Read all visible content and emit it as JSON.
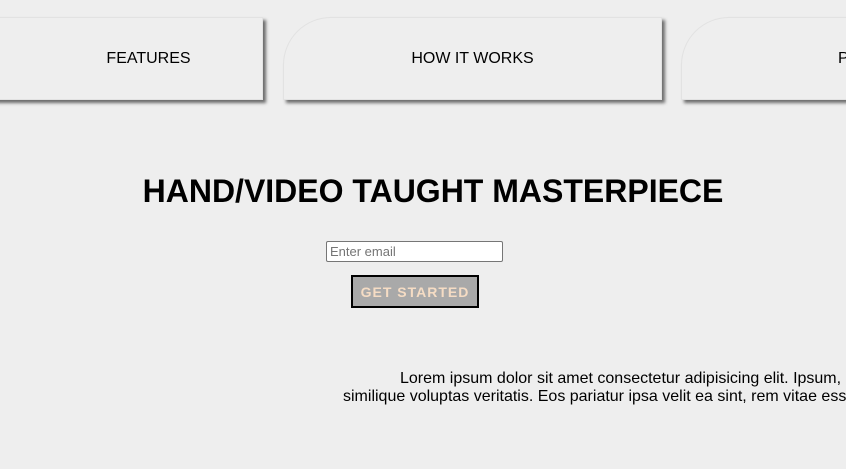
{
  "nav": {
    "tabs": [
      {
        "label": "FEATURES"
      },
      {
        "label": "HOW IT WORKS"
      },
      {
        "label": "P"
      }
    ]
  },
  "hero": {
    "title": "HAND/VIDEO TAUGHT MASTERPIECE",
    "email_placeholder": "Enter email",
    "email_value": "",
    "cta_label": "GET STARTED"
  },
  "description": {
    "line1": "Lorem ipsum dolor sit amet consectetur adipisicing elit. Ipsum, consectetur quis. Doloribus esse sap",
    "line2": "similique voluptas veritatis. Eos pariatur ipsa velit ea sint, rem vitae ess"
  },
  "colors": {
    "background": "#eeeeee",
    "button_bg": "#a9a9a9",
    "button_text": "#f5dcc4"
  }
}
